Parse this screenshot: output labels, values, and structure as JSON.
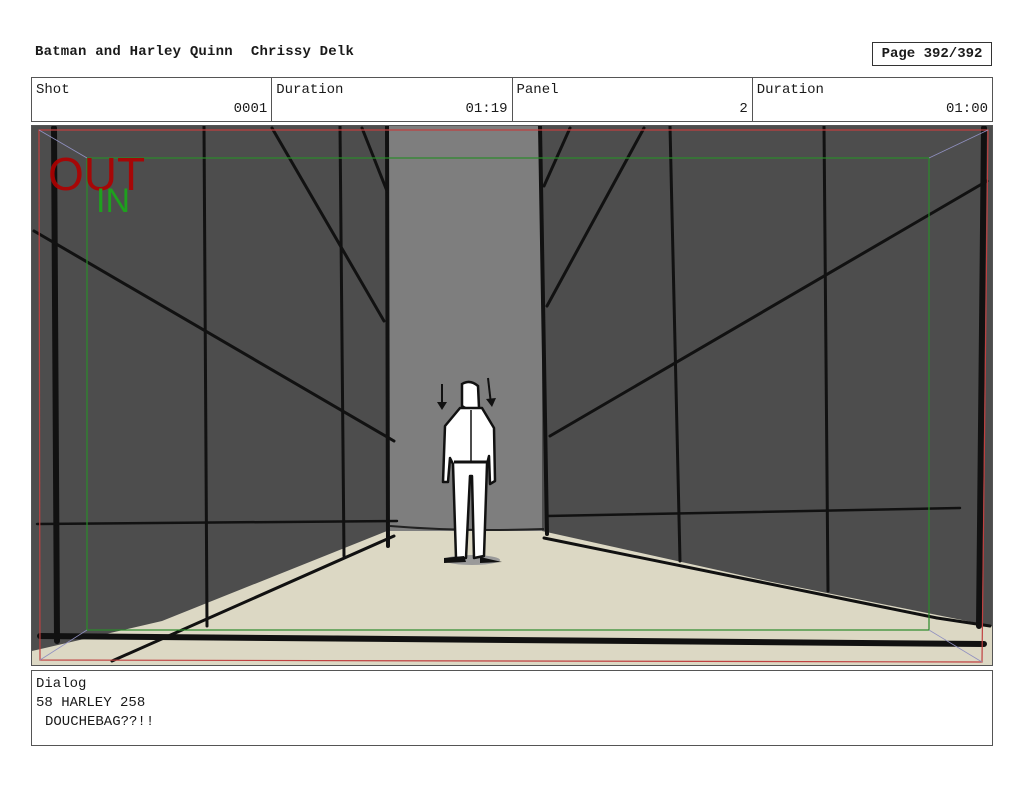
{
  "header": {
    "title": "Batman and Harley Quinn",
    "author": "Chrissy Delk",
    "page": "Page 392/392"
  },
  "info": {
    "shot_label": "Shot",
    "shot_value": "0001",
    "duration1_label": "Duration",
    "duration1_value": "01:19",
    "panel_label": "Panel",
    "panel_value": "2",
    "duration2_label": "Duration",
    "duration2_value": "01:00"
  },
  "panel_marks": {
    "out_label": "OUT",
    "in_label": "IN",
    "out_color": "#b00000",
    "in_color": "#1ea01e"
  },
  "dialog": {
    "label": "Dialog",
    "speaker_line": "58 HARLEY 258",
    "text": "DOUCHEBAG??!!"
  },
  "colors": {
    "wall": "#4d4d4d",
    "back_wall": "#7e7e7e",
    "floor": "#dcd8c4",
    "safe_frame": "#2a8a2a",
    "outer_frame": "#c04040"
  }
}
